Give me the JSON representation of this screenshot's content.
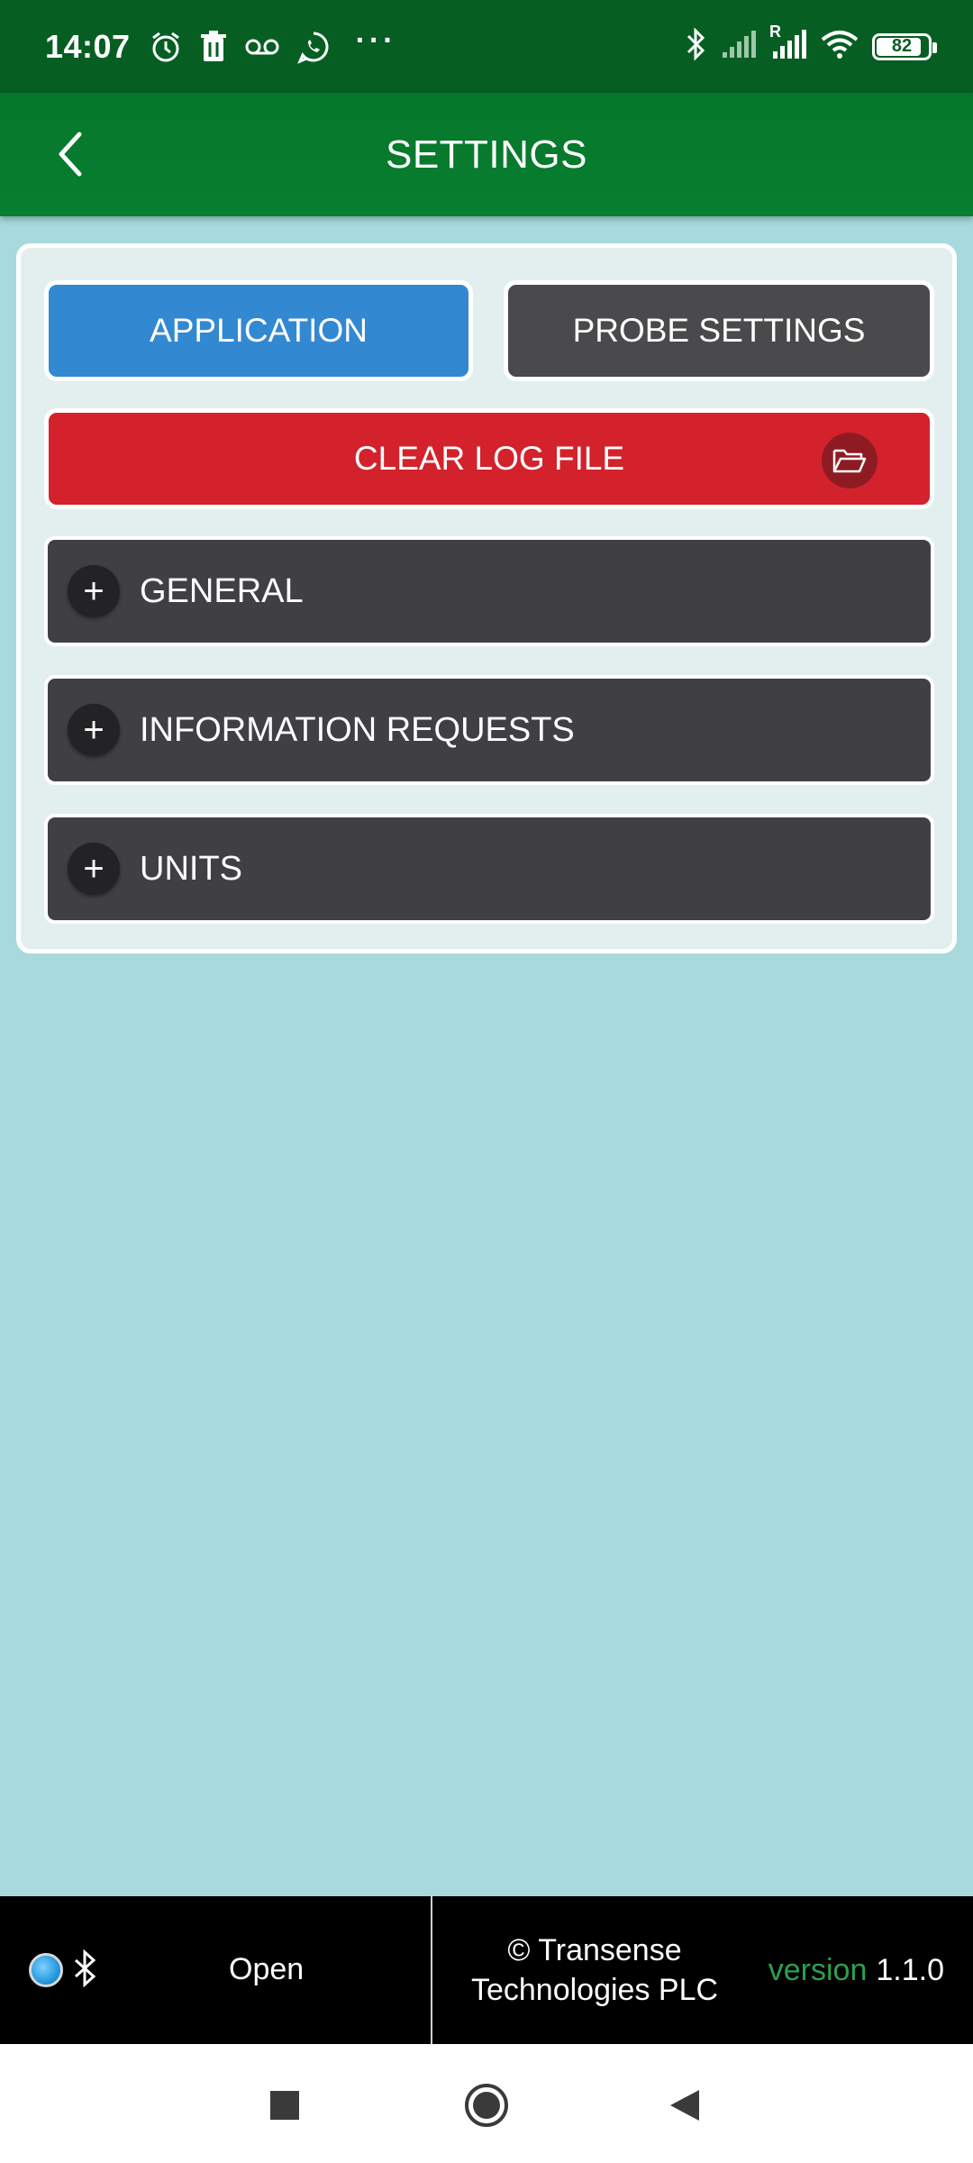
{
  "status_bar": {
    "time": "14:07",
    "battery": "82",
    "icons": [
      "alarm-icon",
      "trash-icon",
      "voicemail-icon",
      "whatsapp-icon",
      "more-dots-icon",
      "bluetooth-icon",
      "signal-icon",
      "signal-roaming-icon",
      "wifi-icon",
      "battery-icon"
    ],
    "roaming_label": "R"
  },
  "app_bar": {
    "title": "SETTINGS",
    "back_icon": "chevron-left-icon"
  },
  "tabs": {
    "application": "APPLICATION",
    "probe_settings": "PROBE SETTINGS"
  },
  "actions": {
    "clear_log": "CLEAR LOG FILE",
    "clear_log_icon": "folder-open-icon"
  },
  "sections": [
    {
      "label": "GENERAL",
      "icon": "plus-icon"
    },
    {
      "label": "INFORMATION REQUESTS",
      "icon": "plus-icon"
    },
    {
      "label": "UNITS",
      "icon": "plus-icon"
    }
  ],
  "footer": {
    "connection_status": "Open",
    "copyright_line1": "© Transense",
    "copyright_line2": "Technologies PLC",
    "version_label": "version",
    "version_number": "1.1.0"
  },
  "colors": {
    "status_bar": "#075e23",
    "app_bar": "#087e30",
    "background": "#a8d9dd",
    "application_button": "#3388d2",
    "probe_button": "#4a4a4c",
    "clear_button": "#d3222c",
    "section": "#404044",
    "version_label": "#2e9f4e"
  }
}
